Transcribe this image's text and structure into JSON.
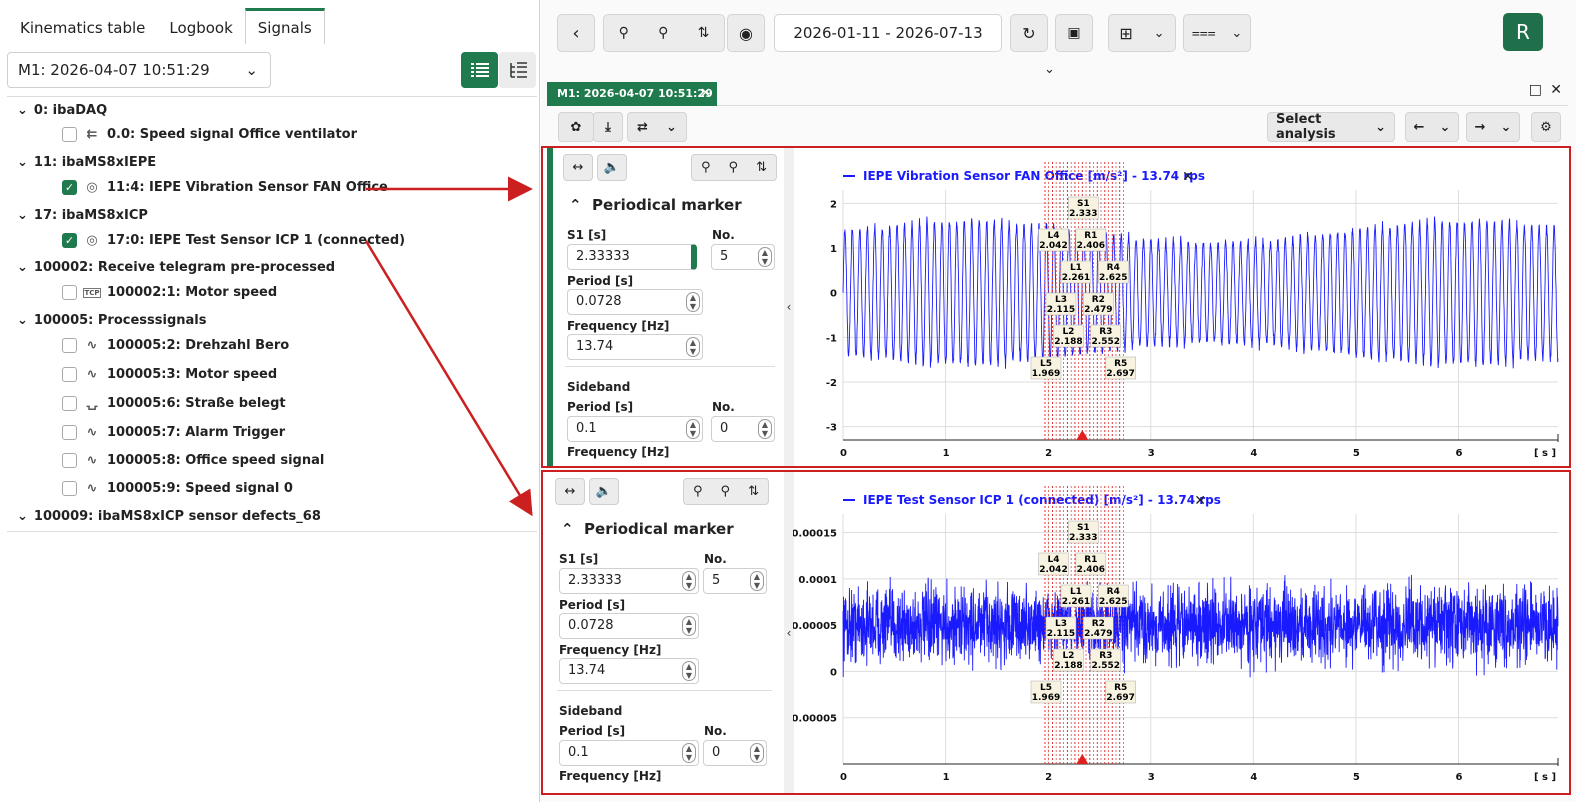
{
  "left": {
    "tabs": [
      "Kinematics table",
      "Logbook",
      "Signals"
    ],
    "measurement": "M1: 2026-04-07 10:51:29",
    "tree": [
      {
        "group": "0: ibaDAQ",
        "items": [
          {
            "label": "0.0: Speed signal Office ventilator",
            "checked": false,
            "icon": "digital-speed-icon"
          }
        ]
      },
      {
        "group": "11: ibaMS8xIEPE",
        "items": [
          {
            "label": "11:4: IEPE Vibration Sensor FAN Office",
            "checked": true,
            "icon": "vibration-sensor-icon"
          }
        ]
      },
      {
        "group": "17: ibaMS8xICP",
        "items": [
          {
            "label": "17:0: IEPE Test Sensor ICP 1 (connected)",
            "checked": true,
            "icon": "vibration-sensor-icon"
          }
        ]
      },
      {
        "group": "100002: Receive telegram pre-processed",
        "items": [
          {
            "label": "100002:1: Motor speed",
            "checked": false,
            "icon": "tcp-icon"
          }
        ]
      },
      {
        "group": "100005: Processsignals",
        "items": [
          {
            "label": "100005:2: Drehzahl Bero",
            "checked": false,
            "icon": "analog-wave-icon"
          },
          {
            "label": "100005:3: Motor speed",
            "checked": false,
            "icon": "analog-wave-icon"
          },
          {
            "label": "100005:6: Straße belegt",
            "checked": false,
            "icon": "digital-pulse-icon"
          },
          {
            "label": "100005:7: Alarm Trigger",
            "checked": false,
            "icon": "analog-wave-icon"
          },
          {
            "label": "100005:8: Office speed signal",
            "checked": false,
            "icon": "analog-wave-icon"
          },
          {
            "label": "100005:9: Speed signal 0",
            "checked": false,
            "icon": "analog-wave-icon"
          }
        ]
      },
      {
        "group": "100009: ibaMS8xICP sensor defects_68",
        "items": []
      }
    ]
  },
  "toolbar": {
    "date_range": "2026-01-11  -  2026-07-13",
    "avatar": "R"
  },
  "doc_tab": "M1: 2026-04-07 10:51:29",
  "analysis": {
    "select_label": "Select analysis"
  },
  "panels": [
    {
      "section_title": "Periodical marker",
      "s1_label": "S1 [s]",
      "s1_value": "2.33333",
      "no_label": "No.",
      "no_value": "5",
      "period_label": "Period [s]",
      "period_value": "0.0728",
      "freq_label": "Frequency [Hz]",
      "freq_value": "13.74",
      "sideband_label": "Sideband",
      "sb_period_label": "Period [s]",
      "sb_period_value": "0.1",
      "sb_no_label": "No.",
      "sb_no_value": "0",
      "sb_freq_label": "Frequency [Hz]",
      "chart_title": "IEPE Vibration Sensor FAN Office [m/s²] - 13.74 rps",
      "yticks": [
        "2",
        "1",
        "0",
        "-1",
        "-2",
        "-3"
      ],
      "xticks": [
        "0",
        "1",
        "2",
        "3",
        "4",
        "5",
        "6"
      ],
      "xunit": "[ s ]"
    },
    {
      "section_title": "Periodical marker",
      "s1_label": "S1 [s]",
      "s1_value": "2.33333",
      "no_label": "No.",
      "no_value": "5",
      "period_label": "Period [s]",
      "period_value": "0.0728",
      "freq_label": "Frequency [Hz]",
      "freq_value": "13.74",
      "sideband_label": "Sideband",
      "sb_period_label": "Period [s]",
      "sb_period_value": "0.1",
      "sb_no_label": "No.",
      "sb_no_value": "0",
      "sb_freq_label": "Frequency [Hz]",
      "chart_title": "IEPE Test Sensor ICP 1 (connected) [m/s²] - 13.74 rps",
      "yticks": [
        "0.00015",
        "0.0001",
        "0.00005",
        "0",
        "-0.00005"
      ],
      "xticks": [
        "0",
        "1",
        "2",
        "3",
        "4",
        "5",
        "6"
      ],
      "xunit": "[ s ]"
    }
  ],
  "chart_data": [
    {
      "type": "line",
      "title": "IEPE Vibration Sensor FAN Office [m/s²] - 13.74 rps",
      "xlabel": "[ s ]",
      "xlim": [
        0,
        6.97
      ],
      "ylim": [
        -3.3,
        2.3
      ],
      "series": [
        {
          "name": "IEPE Vibration Sensor FAN Office",
          "frequency_hz": 13.74,
          "amplitude": 1.6,
          "color": "#1a1aff"
        }
      ],
      "markers": [
        {
          "label": "S1",
          "value": "2.333"
        },
        {
          "label": "L1",
          "value": "2.261"
        },
        {
          "label": "R1",
          "value": "2.406"
        },
        {
          "label": "L2",
          "value": "2.188"
        },
        {
          "label": "R2",
          "value": "2.479"
        },
        {
          "label": "L3",
          "value": "2.115"
        },
        {
          "label": "R3",
          "value": "2.552"
        },
        {
          "label": "L4",
          "value": "2.042"
        },
        {
          "label": "R4",
          "value": "2.625"
        },
        {
          "label": "L5",
          "value": "1.969"
        },
        {
          "label": "R5",
          "value": "2.697"
        }
      ],
      "grid": true
    },
    {
      "type": "line",
      "title": "IEPE Test Sensor ICP 1 (connected) [m/s²] - 13.74 rps",
      "xlabel": "[ s ]",
      "xlim": [
        0,
        6.97
      ],
      "ylim": [
        -0.0001,
        0.00017
      ],
      "series": [
        {
          "name": "IEPE Test Sensor ICP 1 (connected)",
          "mean": 5e-05,
          "noise": 5e-05,
          "color": "#1a1aff"
        }
      ],
      "markers": [
        {
          "label": "S1",
          "value": "2.333"
        },
        {
          "label": "L1",
          "value": "2.261"
        },
        {
          "label": "R1",
          "value": "2.406"
        },
        {
          "label": "L2",
          "value": "2.188"
        },
        {
          "label": "R2",
          "value": "2.479"
        },
        {
          "label": "L3",
          "value": "2.115"
        },
        {
          "label": "R3",
          "value": "2.552"
        },
        {
          "label": "L4",
          "value": "2.042"
        },
        {
          "label": "R4",
          "value": "2.625"
        },
        {
          "label": "L5",
          "value": "1.969"
        },
        {
          "label": "R5",
          "value": "2.697"
        }
      ],
      "grid": true
    }
  ],
  "colors": {
    "accent": "#1f7a4d",
    "highlight": "#cc2020",
    "series": "#1a1aff",
    "marker_line": "#e03030"
  }
}
